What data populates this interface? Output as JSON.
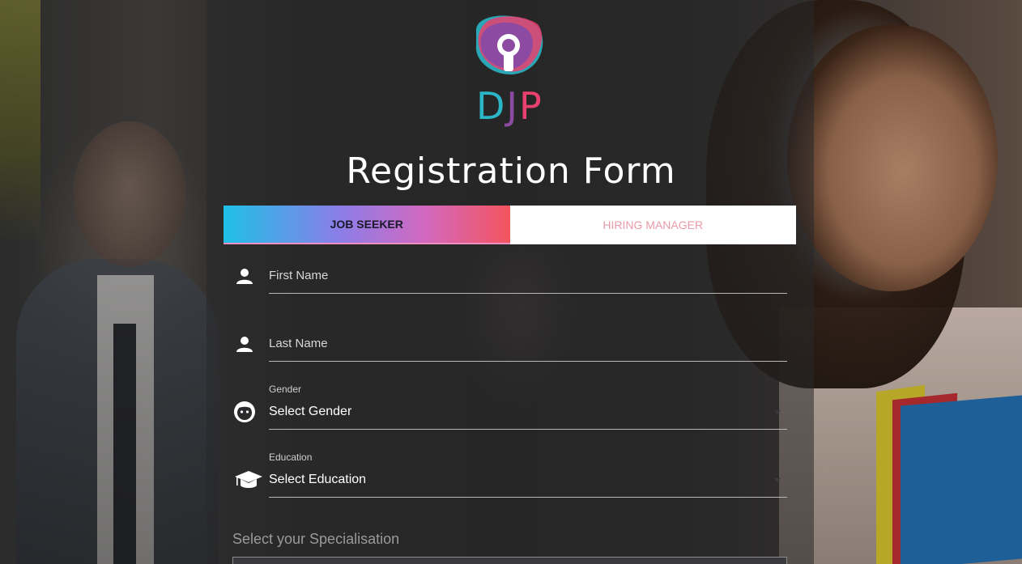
{
  "brand": {
    "letters": [
      "D",
      "J",
      "P"
    ],
    "colors": {
      "teal": "#2bb6c7",
      "purple": "#8d4aa3",
      "pink": "#e8406f"
    }
  },
  "page": {
    "title": "Registration Form"
  },
  "tabs": [
    {
      "label": "JOB SEEKER",
      "active": true
    },
    {
      "label": "HIRING MANAGER",
      "active": false
    }
  ],
  "form": {
    "first_name": {
      "placeholder": "First Name",
      "icon": "person-icon"
    },
    "last_name": {
      "placeholder": "Last Name",
      "icon": "person-icon"
    },
    "gender": {
      "label": "Gender",
      "value": "Select Gender",
      "icon": "face-icon"
    },
    "education": {
      "label": "Education",
      "value": "Select Education",
      "icon": "graduation-cap-icon"
    },
    "specialisation": {
      "label": "Select your Specialisation"
    }
  },
  "accent_gradient": [
    "#1ec0e6",
    "#8a7ee8",
    "#d169c0",
    "#f4545d"
  ]
}
